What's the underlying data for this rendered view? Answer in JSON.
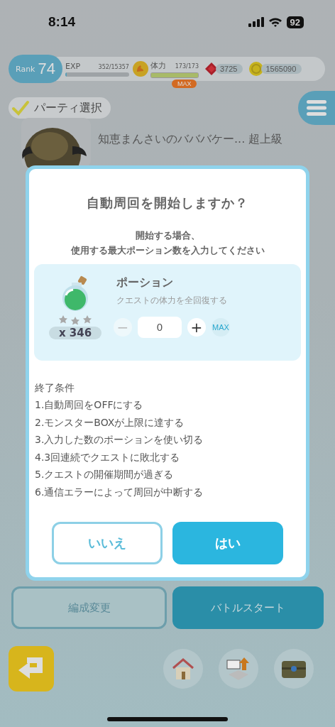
{
  "status_bar": {
    "time": "8:14",
    "battery": "92"
  },
  "header": {
    "rank_label": "Rank",
    "rank": "74",
    "exp": {
      "label": "EXP",
      "value": "352/15357",
      "level": 0.02
    },
    "stamina": {
      "label": "体力",
      "value": "173/173",
      "level": 1,
      "badge": "MAX"
    },
    "gems": "3725",
    "coins": "1565090"
  },
  "party_select": {
    "label": "パーティ選択",
    "checked": true
  },
  "quest": {
    "title": "知恵まんさいのバババケー... 超上級"
  },
  "dialog": {
    "title": "自動周回を開始しますか？",
    "message_lines": [
      "開始する場合、",
      "使用する最大ポーション数を入力してください"
    ],
    "item": {
      "name": "ポーション",
      "description": "クエストの体力を全回復する",
      "count": "x 346",
      "minus": "−",
      "value": "0",
      "plus": "+",
      "max": "MAX"
    },
    "conditions_title": "終了条件",
    "conditions": [
      "1.自動周回をOFFにする",
      "2.モンスターBOXが上限に達する",
      "3.入力した数のポーションを使い切る",
      "4.3回連続でクエストに敗北する",
      "5.クエストの開催期間が過ぎる",
      "6.通信エラーによって周回が中断する"
    ],
    "buttons": [
      {
        "label": "いいえ",
        "kind": "outline"
      },
      {
        "label": "はい",
        "kind": "primary"
      }
    ]
  },
  "actions": [
    {
      "label": "編成変更",
      "kind": "outline"
    },
    {
      "label": "バトルスタート",
      "kind": "primary"
    }
  ],
  "nav": [
    {
      "kind": "back"
    },
    {
      "kind": "home"
    },
    {
      "kind": "levelup"
    },
    {
      "kind": "chest"
    }
  ]
}
